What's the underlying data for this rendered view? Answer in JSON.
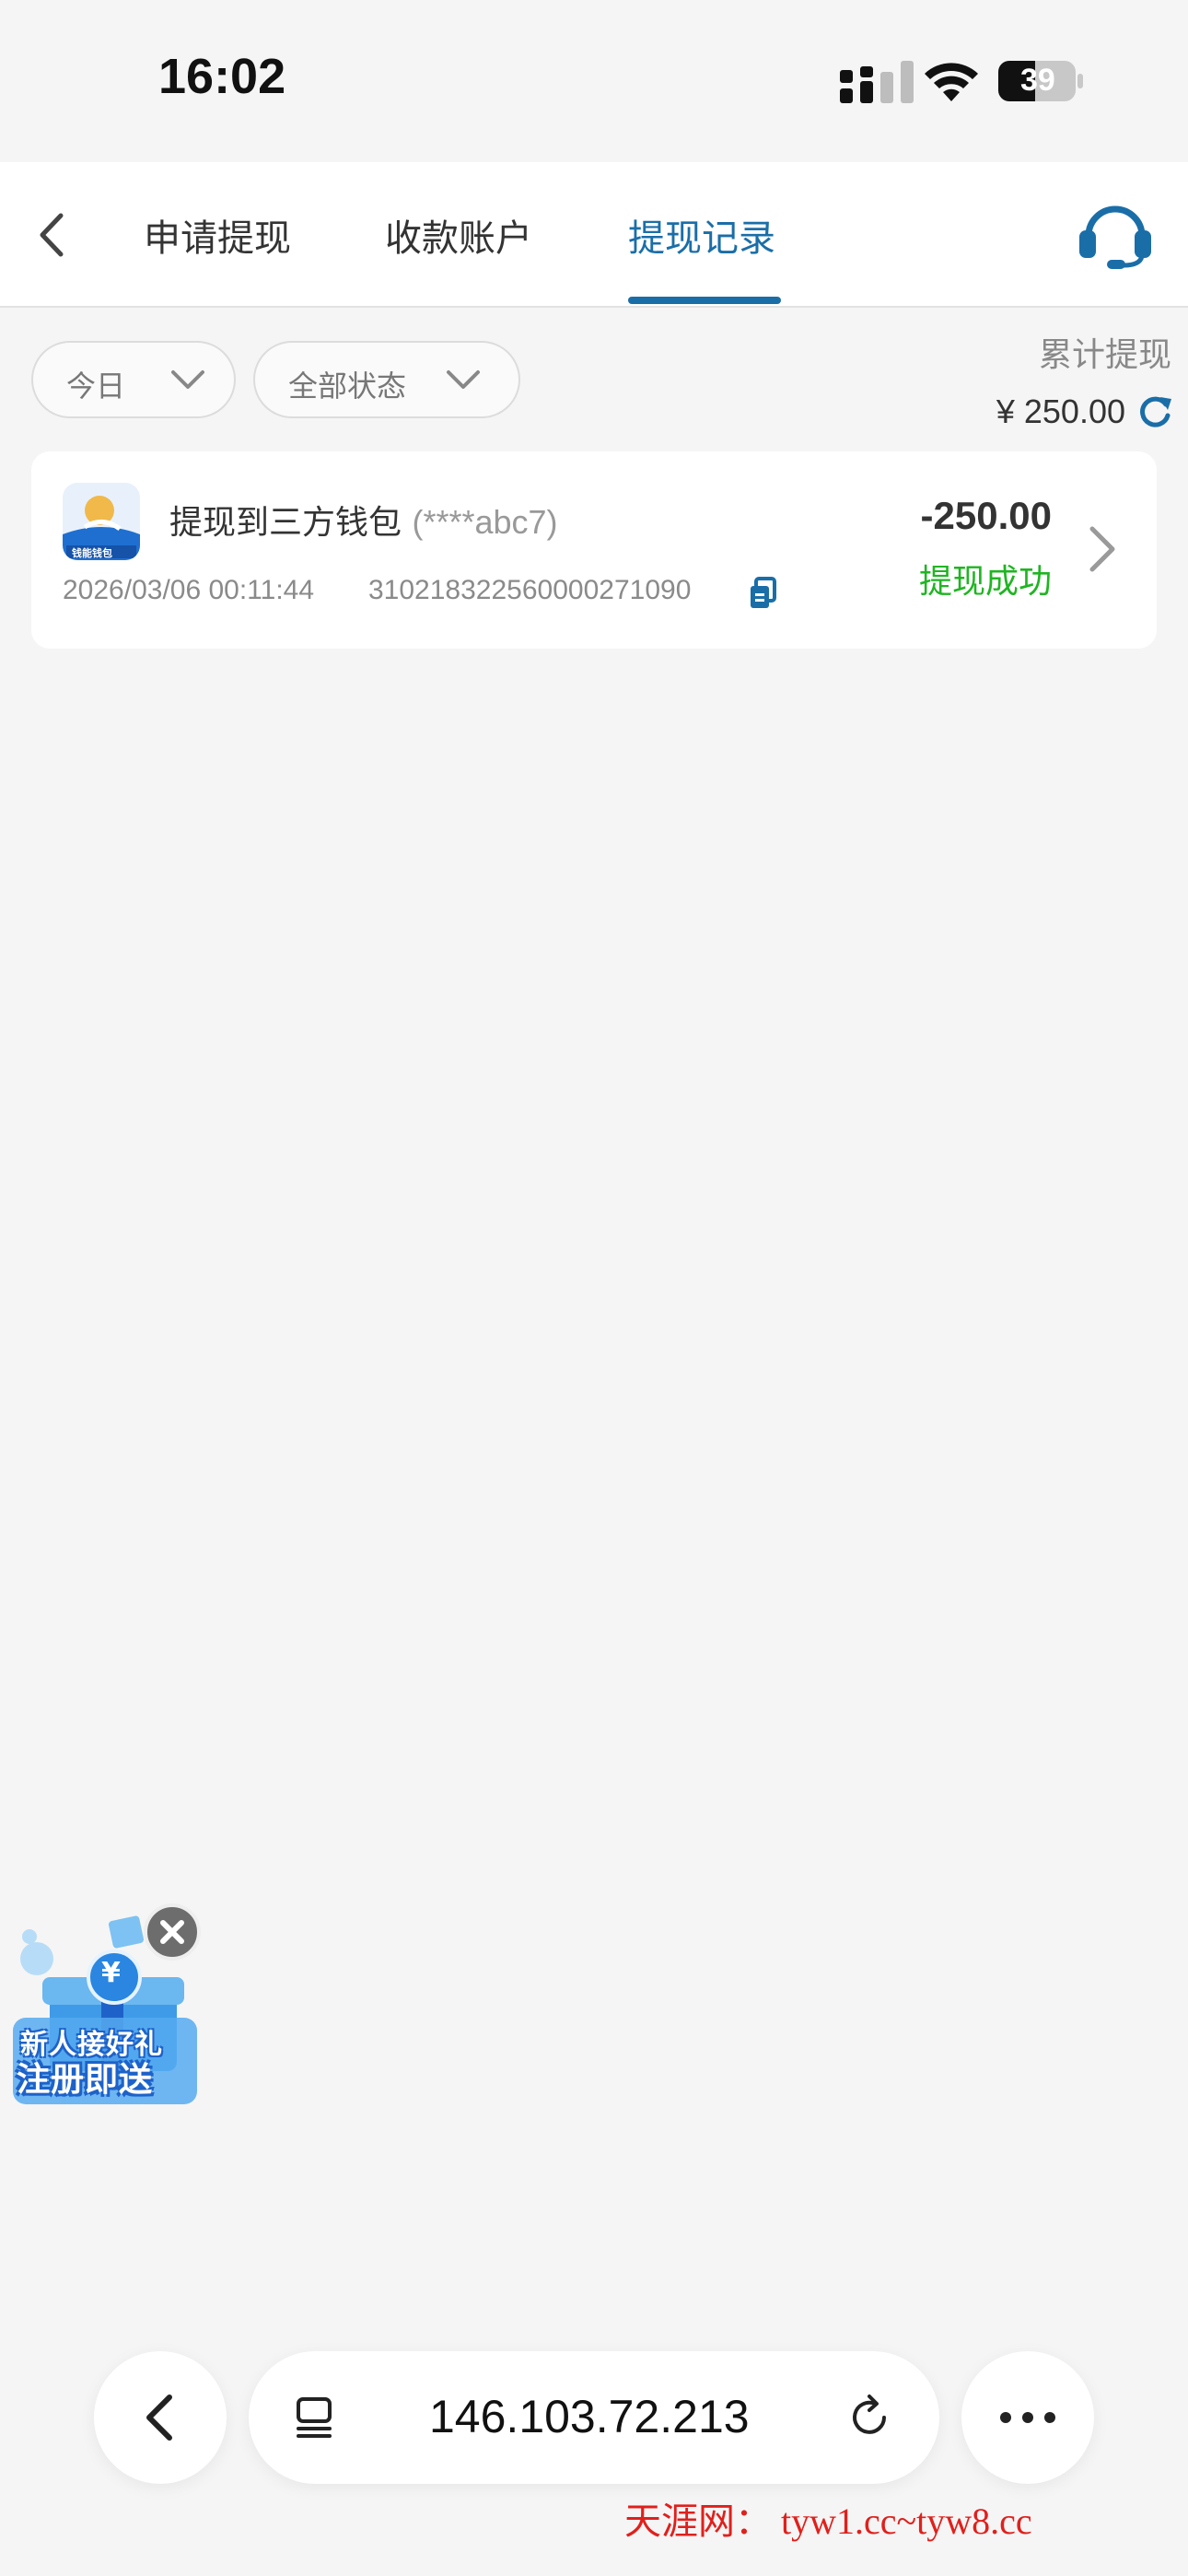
{
  "status_bar": {
    "time": "16:02",
    "battery": "39"
  },
  "nav": {
    "tabs": [
      {
        "label": "申请提现",
        "active": false
      },
      {
        "label": "收款账户",
        "active": false
      },
      {
        "label": "提现记录",
        "active": true
      }
    ],
    "accent_color": "#1a6ea8"
  },
  "filters": {
    "date": "今日",
    "status": "全部状态"
  },
  "summary": {
    "label": "累计提现",
    "value": "¥ 250.00"
  },
  "records": [
    {
      "title": "提现到三方钱包",
      "account_masked": "(****abc7)",
      "datetime": "2026/03/06 00:11:44",
      "order_no": "310218322560000271090",
      "amount": "-250.00",
      "status": "提现成功",
      "status_color": "#1fb522",
      "logo_text": "钱能钱包"
    }
  ],
  "promo": {
    "line1": "新人接好礼",
    "line2": "注册即送",
    "symbol": "¥"
  },
  "browser": {
    "url": "146.103.72.213"
  },
  "watermark": "天涯网： tyw1.cc~tyw8.cc"
}
